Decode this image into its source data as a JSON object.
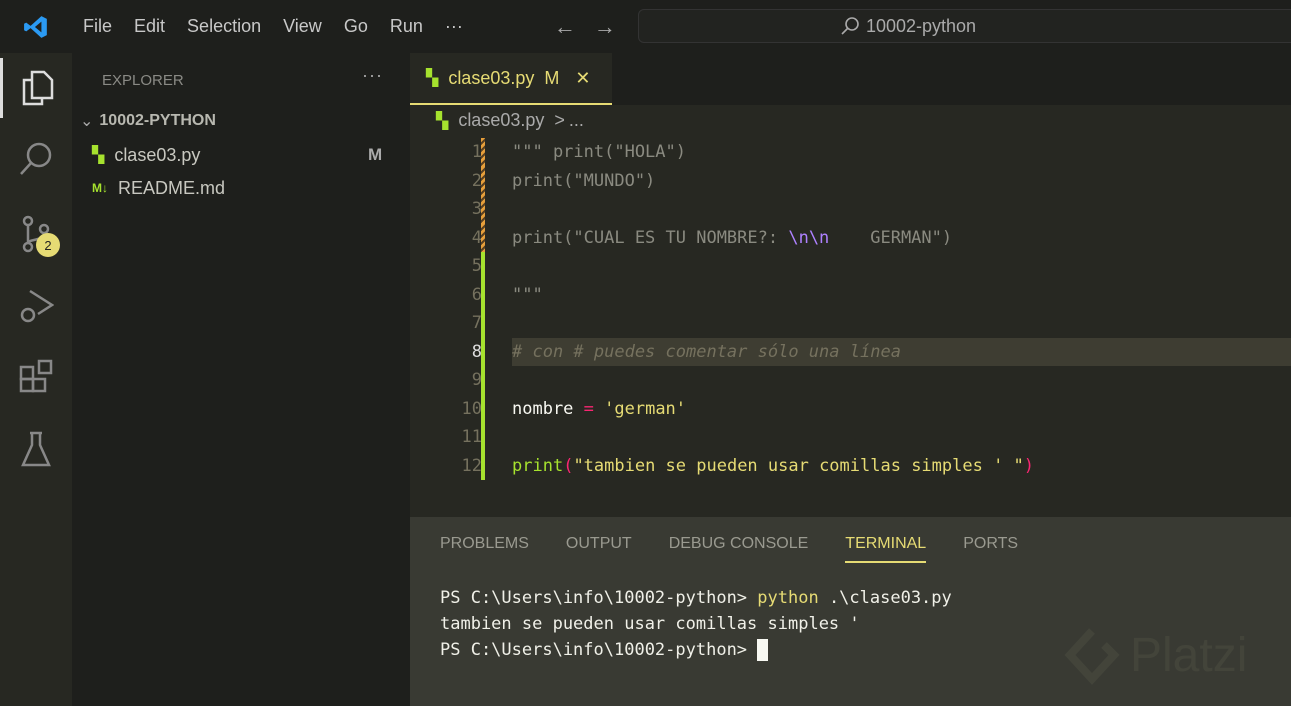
{
  "menu": [
    "File",
    "Edit",
    "Selection",
    "View",
    "Go",
    "Run",
    "···"
  ],
  "search": {
    "label": "10002-python"
  },
  "activity": {
    "scm_badge": "2",
    "items": [
      "explorer-icon",
      "search-icon",
      "source-control-icon",
      "run-debug-icon",
      "extensions-icon",
      "testing-icon"
    ]
  },
  "sidebar": {
    "title": "EXPLORER",
    "more": "···",
    "folder": "10002-PYTHON",
    "files": [
      {
        "name": "clase03.py",
        "status": "M"
      },
      {
        "name": "README.md",
        "status": ""
      }
    ]
  },
  "tab": {
    "label": "clase03.py",
    "status": "M",
    "close": "✕"
  },
  "breadcrumb": {
    "file": "clase03.py",
    "sep": ">",
    "rest": "..."
  },
  "editor": {
    "current_line": 8,
    "lines": [
      {
        "n": "1",
        "gutter": "mod"
      },
      {
        "n": "2",
        "gutter": "mod"
      },
      {
        "n": "3",
        "gutter": "mod"
      },
      {
        "n": "4",
        "gutter": "mod"
      },
      {
        "n": "5",
        "gutter": "add"
      },
      {
        "n": "6",
        "gutter": "add"
      },
      {
        "n": "7",
        "gutter": "add"
      },
      {
        "n": "8",
        "gutter": "add"
      },
      {
        "n": "9",
        "gutter": "add"
      },
      {
        "n": "10",
        "gutter": "add"
      },
      {
        "n": "11",
        "gutter": "add"
      },
      {
        "n": "12",
        "gutter": "add"
      }
    ],
    "code": {
      "l1": "\"\"\" print(\"HOLA\")",
      "l2": "print(\"MUNDO\")",
      "l4a": "print(\"CUAL ES TU NOMBRE?: ",
      "l4b": "\\n\\n",
      "l4c": "    GERMAN\")",
      "l6": "\"\"\"",
      "l8": "# con # puedes comentar sólo una línea",
      "l10a": "nombre ",
      "l10b": "=",
      "l10c": " 'german'",
      "l12a": "print",
      "l12b": "(",
      "l12c": "\"tambien se pueden usar comillas simples ' \"",
      "l12d": ")"
    }
  },
  "panel": {
    "tabs": [
      "PROBLEMS",
      "OUTPUT",
      "DEBUG CONSOLE",
      "TERMINAL",
      "PORTS"
    ],
    "active": "TERMINAL",
    "terminal": {
      "p1": "PS C:\\Users\\info\\10002-python> ",
      "cmd": "python",
      "args": " .\\clase03.py",
      "out": "tambien se pueden usar comillas simples '",
      "p2": "PS C:\\Users\\info\\10002-python> "
    }
  },
  "watermark": "Platzi",
  "colors": {
    "accent": "#e6db74",
    "editor_bg": "#272822",
    "added": "#a6e22e",
    "modified": "#e69f3b"
  }
}
